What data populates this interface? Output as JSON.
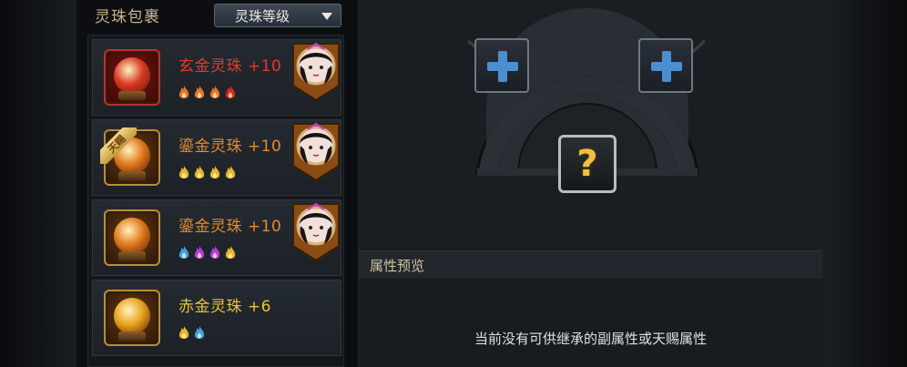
{
  "bag": {
    "title": "灵珠包裹",
    "sort_label": "灵珠等级",
    "items": [
      {
        "name": "玄金灵珠 +10",
        "name_color": "#e23a2a",
        "orb_color": "#d83a22",
        "frame": "red",
        "flames": [
          "orange",
          "orange",
          "orange",
          "red"
        ],
        "equipped": true,
        "ribbon": ""
      },
      {
        "name": "鎏金灵珠 +10",
        "name_color": "#e48a2a",
        "orb_color": "#e07a1e",
        "frame": "gold",
        "flames": [
          "gold",
          "gold",
          "gold",
          "gold"
        ],
        "equipped": true,
        "ribbon": "天赐"
      },
      {
        "name": "鎏金灵珠 +10",
        "name_color": "#e48a2a",
        "orb_color": "#e07a1e",
        "frame": "gold",
        "flames": [
          "blue",
          "purple",
          "purple",
          "gold"
        ],
        "equipped": true,
        "ribbon": ""
      },
      {
        "name": "赤金灵珠 +6",
        "name_color": "#e8c23a",
        "orb_color": "#e8a21e",
        "frame": "gold",
        "flames": [
          "gold",
          "blue"
        ],
        "equipped": false,
        "ribbon": ""
      }
    ]
  },
  "inherit": {
    "attr_title": "属性预览",
    "empty_message": "当前没有可供继承的副属性或天赐属性"
  },
  "colors": {
    "orange": "#e8722a",
    "red": "#d8281e",
    "gold": "#e8b42a",
    "blue": "#3ea0e8",
    "purple": "#b83ae0"
  }
}
